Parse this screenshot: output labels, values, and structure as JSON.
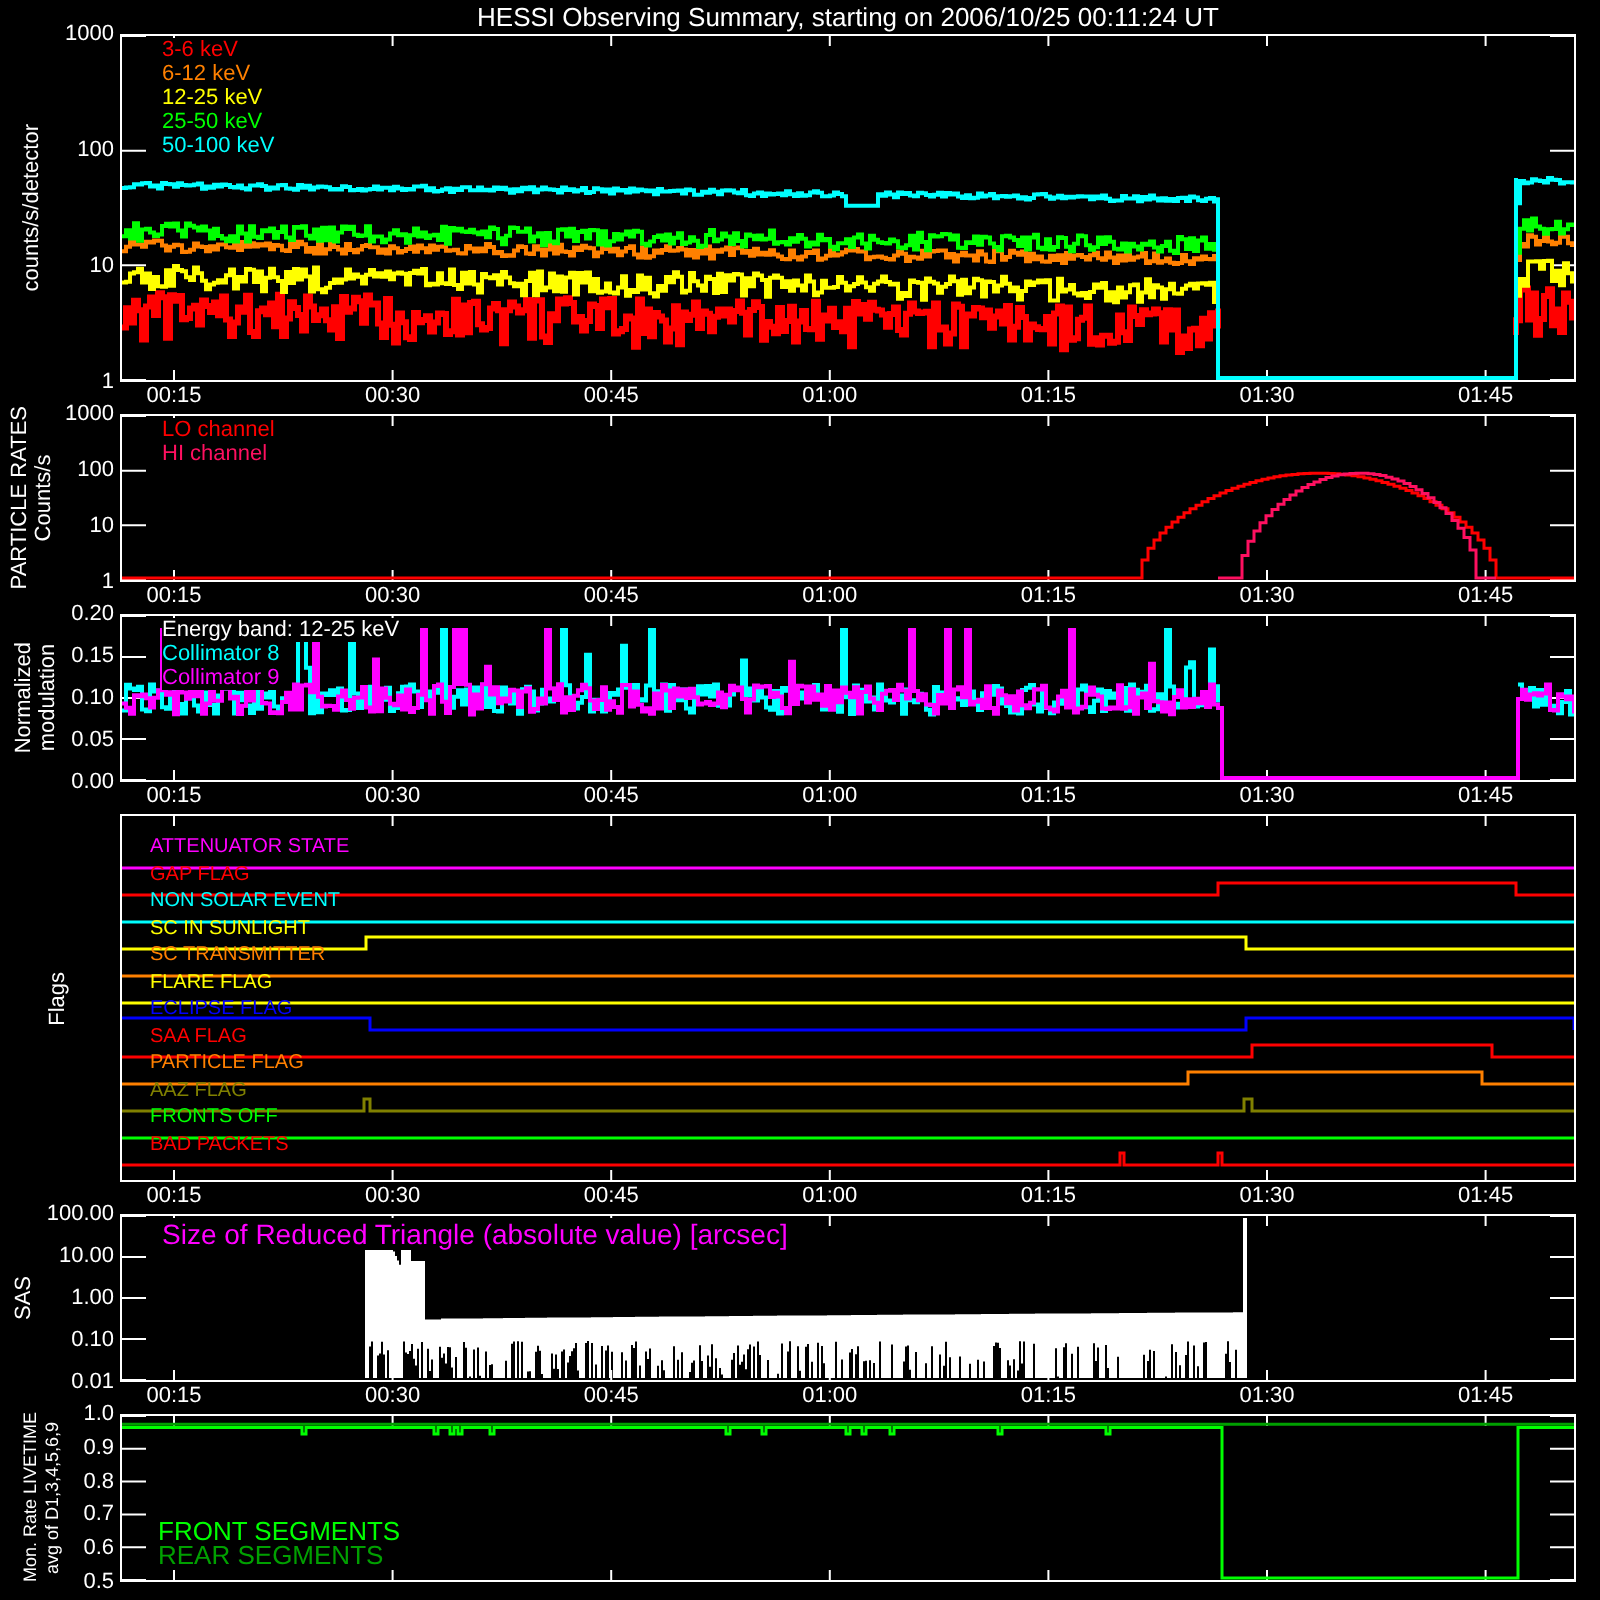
{
  "title": "HESSI Observing Summary, starting on 2006/10/25 00:11:24 UT",
  "panels": [
    {
      "kind": "spectrum",
      "ylabel": [
        "counts/s/detector"
      ],
      "yticks": [
        "1000",
        "100",
        "10",
        "1"
      ],
      "xticks": [
        "00:15",
        "00:30",
        "00:45",
        "01:00",
        "01:15",
        "01:30",
        "01:45"
      ],
      "legend": [
        {
          "label": "3-6 keV",
          "color": "#ff0000"
        },
        {
          "label": "6-12 keV",
          "color": "#ff8000"
        },
        {
          "label": "12-25 keV",
          "color": "#ffff00"
        },
        {
          "label": "25-50 keV",
          "color": "#00ff00"
        },
        {
          "label": "50-100 keV",
          "color": "#00ffff"
        }
      ]
    },
    {
      "kind": "particle",
      "ylabel": [
        "PARTICLE RATES",
        "Counts/s"
      ],
      "yticks": [
        "1000",
        "100",
        "10",
        "1"
      ],
      "xticks": [
        "00:15",
        "00:30",
        "00:45",
        "01:00",
        "01:15",
        "01:30",
        "01:45"
      ],
      "legend": [
        {
          "label": "LO channel",
          "color": "#ff0000"
        },
        {
          "label": "HI channel",
          "color": "#ff1060"
        }
      ]
    },
    {
      "kind": "modulation",
      "ylabel": [
        "Normalized",
        "modulation"
      ],
      "yticks": [
        "0.20",
        "0.15",
        "0.10",
        "0.05",
        "0.00"
      ],
      "xticks": [
        "00:15",
        "00:30",
        "00:45",
        "01:00",
        "01:15",
        "01:30",
        "01:45"
      ],
      "note": "Energy band: 12-25 keV",
      "legend": [
        {
          "label": "Collimator 8",
          "color": "#00ffff"
        },
        {
          "label": "Collimator 9",
          "color": "#ff00ff"
        }
      ]
    },
    {
      "kind": "flags",
      "ylabel": [
        "Flags"
      ],
      "xticks": [
        "00:15",
        "00:30",
        "00:45",
        "01:00",
        "01:15",
        "01:30",
        "01:45"
      ],
      "legend": [
        {
          "label": "ATTENUATOR STATE",
          "color": "#ff00ff"
        },
        {
          "label": "GAP FLAG",
          "color": "#ff0000"
        },
        {
          "label": "NON SOLAR EVENT",
          "color": "#00ffff"
        },
        {
          "label": "SC IN SUNLIGHT",
          "color": "#ffff00"
        },
        {
          "label": "SC TRANSMITTER",
          "color": "#ff8000"
        },
        {
          "label": "FLARE FLAG",
          "color": "#ffff00"
        },
        {
          "label": "ECLIPSE FLAG",
          "color": "#0000ff"
        },
        {
          "label": "SAA FLAG",
          "color": "#ff0000"
        },
        {
          "label": "PARTICLE FLAG",
          "color": "#ff8000"
        },
        {
          "label": "AAZ FLAG",
          "color": "#808000"
        },
        {
          "label": "FRONTS OFF",
          "color": "#00ff00"
        },
        {
          "label": "BAD PACKETS",
          "color": "#ff0000"
        }
      ]
    },
    {
      "kind": "sas",
      "ylabel": [
        "SAS"
      ],
      "yticks": [
        "100.00",
        "10.00",
        "1.00",
        "0.10",
        "0.01"
      ],
      "xticks": [
        "00:15",
        "00:30",
        "00:45",
        "01:00",
        "01:15",
        "01:30",
        "01:45"
      ],
      "note": "Size of Reduced Triangle (absolute value) [arcsec]"
    },
    {
      "kind": "livetime",
      "ylabel": [
        "Mon. Rate LIVETIME",
        "avg of D1,3,4,5,6,9"
      ],
      "yticks": [
        "1.0",
        "0.9",
        "0.8",
        "0.7",
        "0.6",
        "0.5"
      ],
      "legend": [
        {
          "label": "FRONT SEGMENTS",
          "color": "#00ff00"
        },
        {
          "label": "REAR SEGMENTS",
          "color": "#00a000"
        }
      ]
    }
  ]
}
